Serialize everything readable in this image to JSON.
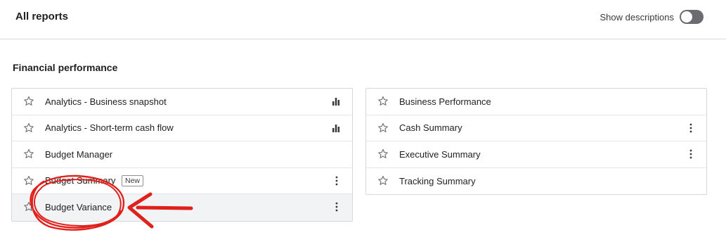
{
  "header": {
    "title": "All reports",
    "show_descriptions_label": "Show descriptions",
    "show_descriptions_on": false
  },
  "section": {
    "title": "Financial performance"
  },
  "left_reports": [
    {
      "label": "Analytics - Business snapshot",
      "icon": "bar-chart-icon"
    },
    {
      "label": "Analytics - Short-term cash flow",
      "icon": "bar-chart-icon"
    },
    {
      "label": "Budget Manager"
    },
    {
      "label": "Budget Summary",
      "badge": "New",
      "menu": true
    },
    {
      "label": "Budget Variance",
      "menu": true
    }
  ],
  "right_reports": [
    {
      "label": "Business Performance"
    },
    {
      "label": "Cash Summary",
      "menu": true
    },
    {
      "label": "Executive Summary",
      "menu": true
    },
    {
      "label": "Tracking Summary"
    }
  ],
  "colors": {
    "annotation_red": "#e0201b",
    "toggle_off": "#6b6c72"
  }
}
